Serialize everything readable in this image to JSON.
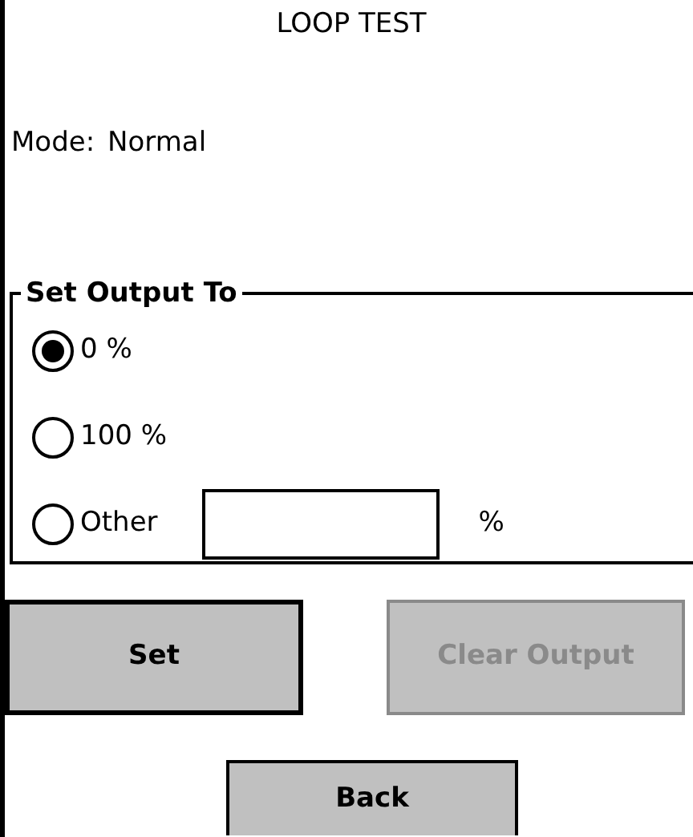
{
  "title": "LOOP TEST",
  "mode": {
    "label": "Mode:",
    "value": "Normal"
  },
  "output_group": {
    "legend": "Set Output To",
    "options": [
      {
        "label": "0 %",
        "selected": true,
        "kind": "radio"
      },
      {
        "label": "100 %",
        "selected": false,
        "kind": "radio"
      },
      {
        "label": "Other",
        "selected": false,
        "kind": "radio_with_field",
        "unit": "%"
      }
    ]
  },
  "buttons": [
    {
      "label": "Set",
      "disabled": false,
      "default": true
    },
    {
      "label": "Clear Output",
      "disabled": true,
      "default": false
    }
  ],
  "back_button": {
    "label": "Back"
  }
}
